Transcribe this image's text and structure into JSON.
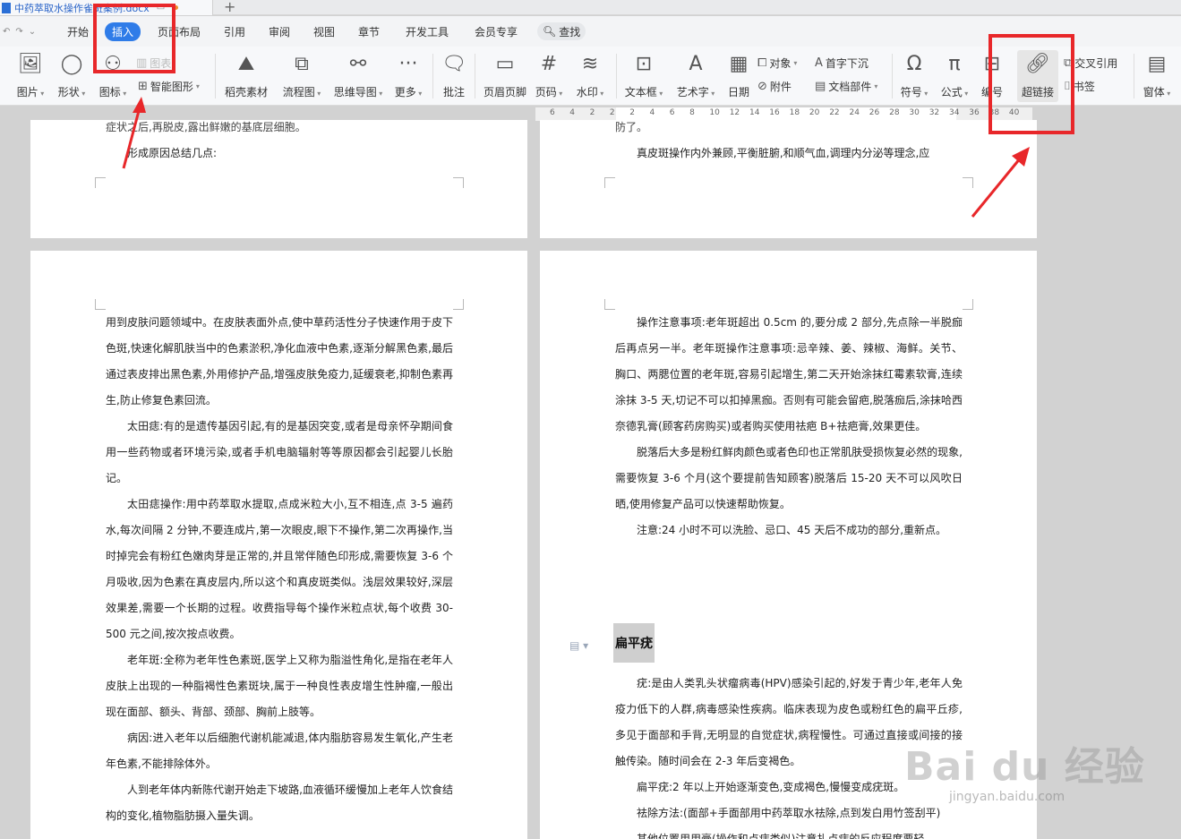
{
  "document": {
    "tab_title": "中药萃取水操作雀斑案例.docx"
  },
  "menu": {
    "tabs": [
      "开始",
      "插入",
      "页面布局",
      "引用",
      "审阅",
      "视图",
      "章节",
      "开发工具",
      "会员专享"
    ],
    "active": "插入",
    "search_label": "查找"
  },
  "ribbon": {
    "picture": "图片",
    "shape": "形状",
    "icon": "图标",
    "smart_graphic": "智能图形",
    "chart": "图表",
    "material": "稻壳素材",
    "flowchart": "流程图",
    "mindmap": "思维导图",
    "more": "更多",
    "comment": "批注",
    "header_footer": "页眉页脚",
    "page_number": "页码",
    "watermark": "水印",
    "textbox": "文本框",
    "wordart": "艺术字",
    "date": "日期",
    "object": "对象",
    "attachment": "附件",
    "dropcap": "首字下沉",
    "doc_parts": "文档部件",
    "symbol": "符号",
    "formula": "公式",
    "numbering": "编号",
    "hyperlink": "超链接",
    "cross_ref": "交叉引用",
    "bookmark": "书签",
    "form": "窗体"
  },
  "ruler": {
    "numbers": [
      "6",
      "4",
      "2",
      "2",
      "2",
      "4",
      "6",
      "8",
      "10",
      "12",
      "14",
      "16",
      "18",
      "20",
      "22",
      "24",
      "26",
      "28",
      "30",
      "32",
      "34",
      "36",
      "38",
      "40"
    ]
  },
  "pages": {
    "top_left": {
      "line1": "症状之后,再脱皮,露出鲜嫩的基底层细胞。",
      "line2": "形成原因总结几点:"
    },
    "top_right": {
      "line1": "防了。",
      "line2": "真皮斑操作内外兼顾,平衡脏腑,和顺气血,调理内分泌等理念,应"
    },
    "bottom_left": {
      "paragraphs": [
        "用到皮肤问题领域中。在皮肤表面外点,使中草药活性分子快速作用于皮下色斑,快速化解肌肤当中的色素淤积,净化血液中色素,逐渐分解黑色素,最后通过表皮排出黑色素,外用修护产品,增强皮肤免疫力,延缓衰老,抑制色素再生,防止修复色素回流。",
        "太田痣:有的是遗传基因引起,有的是基因突变,或者是母亲怀孕期间食用一些药物或者环境污染,或者手机电脑辐射等等原因都会引起婴儿长胎记。",
        "太田痣操作:用中药萃取水提取,点成米粒大小,互不相连,点 3-5 遍药水,每次间隔 2 分钟,不要连成片,第一次眼皮,眼下不操作,第二次再操作,当时掉完会有粉红色嫩肉芽是正常的,并且常伴随色印形成,需要恢复 3-6 个月吸收,因为色素在真皮层内,所以这个和真皮斑类似。浅层效果较好,深层效果差,需要一个长期的过程。收费指导每个操作米粒点状,每个收费 30-500 元之间,按次按点收费。",
        "老年斑:全称为老年性色素斑,医学上又称为脂溢性角化,是指在老年人皮肤上出现的一种脂褐性色素斑块,属于一种良性表皮增生性肿瘤,一般出现在面部、额头、背部、颈部、胸前上肢等。",
        "病因:进入老年以后细胞代谢机能减退,体内脂肪容易发生氧化,产生老年色素,不能排除体外。",
        "人到老年体内新陈代谢开始走下坡路,血液循环缓慢加上老年人饮食结构的变化,植物脂肪摄入量失调。"
      ]
    },
    "bottom_right": {
      "paragraphs_top": [
        "操作注意事项:老年斑超出 0.5cm 的,要分成 2 部分,先点除一半脱痂后再点另一半。老年斑操作注意事项:忌辛辣、姜、辣椒、海鲜。关节、胸口、两腮位置的老年斑,容易引起增生,第二天开始涂抹红霉素软膏,连续涂抹 3-5 天,切记不可以扣掉黑痂。否则有可能会留疤,脱落痂后,涂抹哈西奈德乳膏(顾客药房购买)或者购买使用祛疤 B+祛疤膏,效果更佳。",
        "脱落后大多是粉红鲜肉颜色或者色印也正常肌肤受损恢复必然的现象,需要恢复 3-6 个月(这个要提前告知顾客)脱落后 15-20 天不可以风吹日晒,使用修复产品可以快速帮助恢复。",
        "注意:24 小时不可以洗脸、忌口、45 天后不成功的部分,重新点。"
      ],
      "heading": "扁平疣",
      "paragraphs_bottom": [
        "疣:是由人类乳头状瘤病毒(HPV)感染引起的,好发于青少年,老年人免疫力低下的人群,病毒感染性疾病。临床表现为皮色或粉红色的扁平丘疹,多见于面部和手背,无明显的自觉症状,病程慢性。可通过直接或间接的接触传染。随时间会在 2-3 年后变褐色。",
        "扁平疣:2 年以上开始逐渐变色,变成褐色,慢慢变成疣斑。",
        "祛除方法:(面部+手面部用中药萃取水祛除,点到发白用竹签刮平)",
        "其他位置用用膏(操作和点痣类似)注意扎点痣的反应程度要轻"
      ]
    }
  },
  "watermark": {
    "text": "Bai du 经验",
    "sub": "jingyan.baidu.com"
  },
  "colors": {
    "accent": "#2f7ce8",
    "annotation_red": "#e8272a",
    "workspace": "#d2d2d2"
  }
}
